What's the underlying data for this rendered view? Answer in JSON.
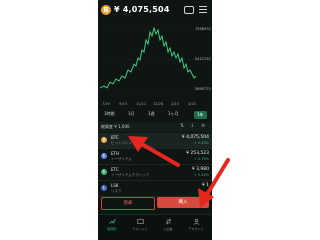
{
  "header": {
    "coin_symbol": "B",
    "balance": "¥ 4,075,504",
    "icons": [
      "chat-icon",
      "menu-icon"
    ]
  },
  "chart": {
    "price_ticks": [
      "7558970",
      "5412720",
      "3895773"
    ],
    "x_labels": [
      "7/19",
      "9/13",
      "11/11",
      "12/28",
      "2/23",
      "4/15"
    ],
    "ranges": [
      "1時間",
      "1日",
      "1週",
      "1ヶ月",
      "1年"
    ],
    "active_range": "1年",
    "line_color": "#3fd98b"
  },
  "filter": {
    "label": "総資産 ¥ 1,000",
    "icons": [
      "sort-icon",
      "down-icon",
      "settings-icon"
    ]
  },
  "coins": [
    {
      "symbol": "BTC",
      "name": "ビットコイン",
      "price": "¥ 4,075,504",
      "change": "+ 5.44%",
      "color": "#f2a33a",
      "glyph": "B"
    },
    {
      "symbol": "ETH",
      "name": "イーサリアム",
      "price": "¥ 253,523",
      "change": "+ 2.79%",
      "color": "#627eea",
      "glyph": "E"
    },
    {
      "symbol": "ETC",
      "name": "イーサリアムクラシック",
      "price": "¥ 3,980",
      "change": "+ 3.45%",
      "color": "#3cb371",
      "glyph": "E"
    },
    {
      "symbol": "LSK",
      "name": "リスク",
      "price": "¥ 1",
      "change": "",
      "color": "#4a6bd1",
      "glyph": "L"
    }
  ],
  "actions": {
    "sell_label": "売却",
    "buy_label": "購入"
  },
  "nav": [
    {
      "label": "販売所",
      "icon": "chart-icon",
      "active": true
    },
    {
      "label": "ウォレット",
      "icon": "wallet-icon",
      "active": false
    },
    {
      "label": "入出金",
      "icon": "transfer-icon",
      "active": false
    },
    {
      "label": "アカウント",
      "icon": "account-icon",
      "active": false
    }
  ],
  "annotation_color": "#e8261f"
}
